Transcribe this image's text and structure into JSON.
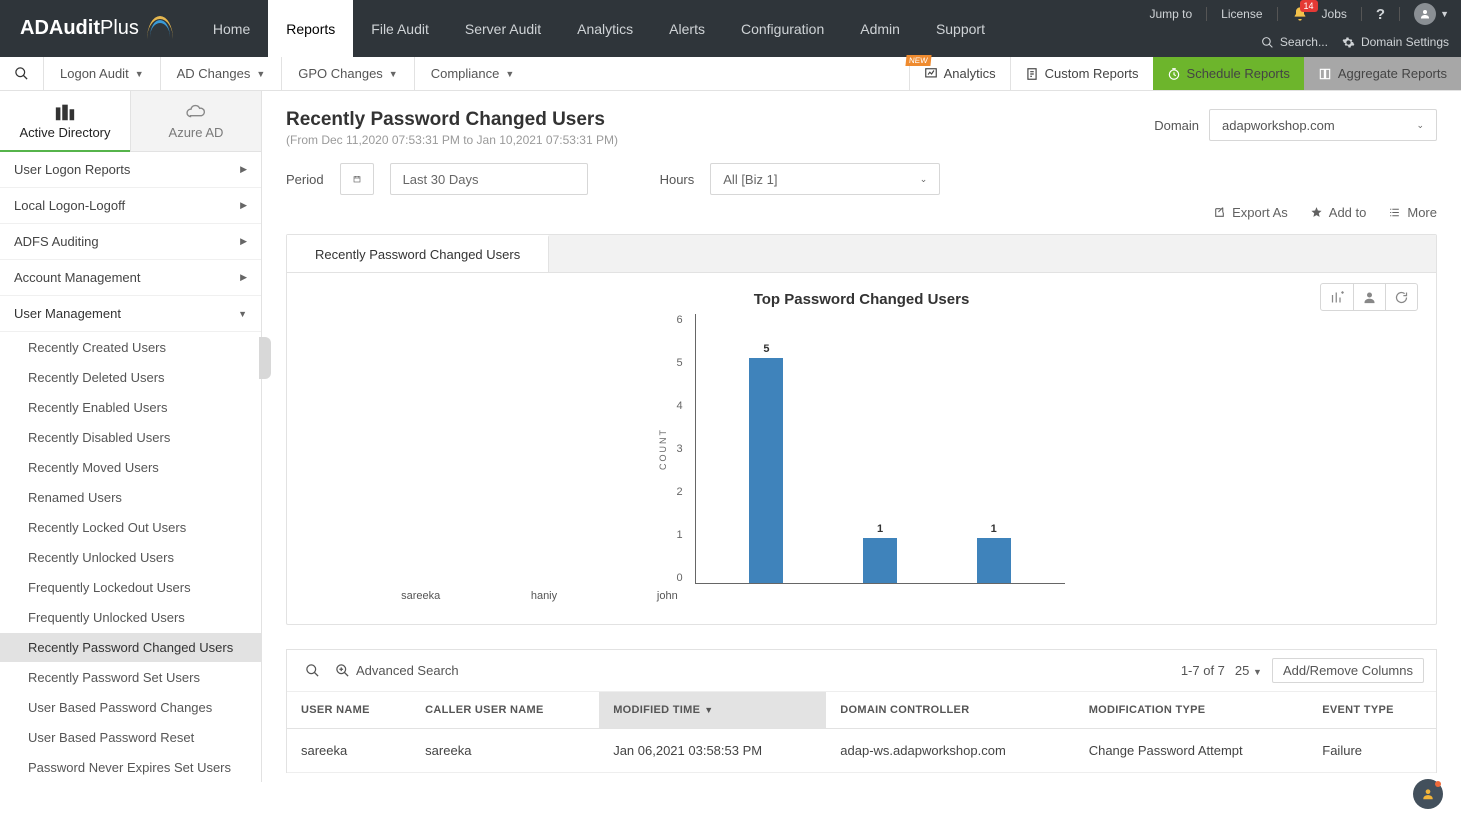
{
  "brand": {
    "name": "ADAudit",
    "suffix": " Plus"
  },
  "topnav": [
    "Home",
    "Reports",
    "File Audit",
    "Server Audit",
    "Analytics",
    "Alerts",
    "Configuration",
    "Admin",
    "Support"
  ],
  "topnav_active": 1,
  "toputil": {
    "jump": "Jump to",
    "license": "License",
    "jobs": "Jobs",
    "help": "?",
    "notif_count": "14",
    "search": "Search...",
    "domain_settings": "Domain Settings"
  },
  "subnav": {
    "items": [
      "Logon Audit",
      "AD Changes",
      "GPO Changes",
      "Compliance"
    ],
    "analytics": "Analytics",
    "custom": "Custom Reports",
    "schedule": "Schedule Reports",
    "aggregate": "Aggregate Reports",
    "new": "NEW"
  },
  "srctabs": {
    "ad": "Active Directory",
    "az": "Azure AD"
  },
  "side_categories": [
    {
      "label": "User Logon Reports"
    },
    {
      "label": "Local Logon-Logoff"
    },
    {
      "label": "ADFS Auditing"
    },
    {
      "label": "Account Management"
    },
    {
      "label": "User Management",
      "expanded": true
    }
  ],
  "side_sub": [
    "Recently Created Users",
    "Recently Deleted Users",
    "Recently Enabled Users",
    "Recently Disabled Users",
    "Recently Moved Users",
    "Renamed Users",
    "Recently Locked Out Users",
    "Recently Unlocked Users",
    "Frequently Lockedout Users",
    "Frequently Unlocked Users",
    "Recently Password Changed Users",
    "Recently Password Set Users",
    "User Based Password Changes",
    "User Based Password Reset",
    "Password Never Expires Set Users"
  ],
  "side_sub_active": 10,
  "page": {
    "title": "Recently Password Changed Users",
    "range": "(From Dec 11,2020 07:53:31 PM to Jan 10,2021 07:53:31 PM)",
    "domain_label": "Domain",
    "domain_value": "adapworkshop.com",
    "period_label": "Period",
    "period_value": "Last 30 Days",
    "hours_label": "Hours",
    "hours_value": "All [Biz 1]"
  },
  "toolbar": {
    "export": "Export As",
    "addto": "Add to",
    "more": "More"
  },
  "panel_tab": "Recently Password Changed Users",
  "chart_data": {
    "type": "bar",
    "title": "Top Password Changed Users",
    "ylabel": "COUNT",
    "ylim": [
      0,
      6
    ],
    "yticks": [
      0,
      1,
      2,
      3,
      4,
      5,
      6
    ],
    "categories": [
      "sareeka",
      "haniy",
      "john"
    ],
    "values": [
      5,
      1,
      1
    ]
  },
  "table": {
    "search_adv": "Advanced Search",
    "count": "1-7 of 7",
    "perpage": "25",
    "cols_btn": "Add/Remove Columns",
    "headers": [
      "USER NAME",
      "CALLER USER NAME",
      "MODIFIED TIME",
      "DOMAIN CONTROLLER",
      "MODIFICATION TYPE",
      "EVENT TYPE"
    ],
    "sorted_col": 2,
    "rows": [
      {
        "user": "sareeka",
        "caller": "sareeka",
        "time": "Jan 06,2021 03:58:53 PM",
        "dc": "adap-ws.adapworkshop.com",
        "mod": "Change Password Attempt",
        "event": "Failure"
      }
    ]
  }
}
